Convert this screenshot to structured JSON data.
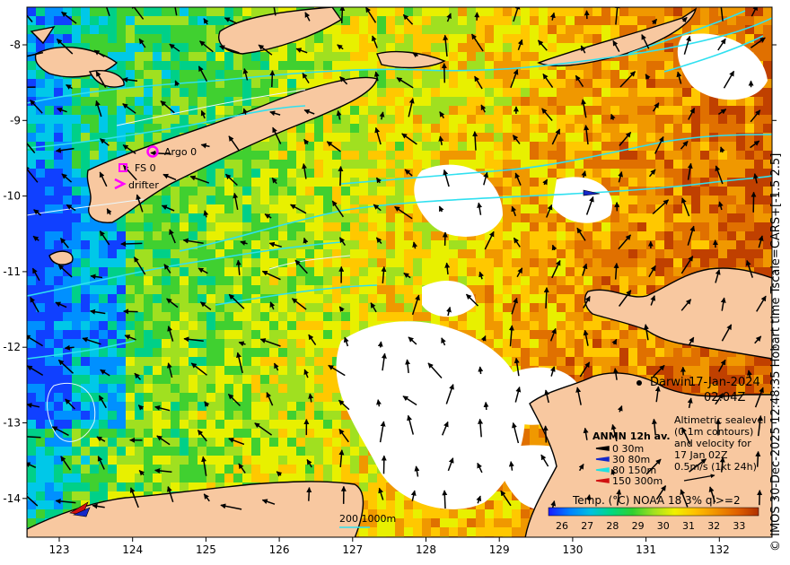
{
  "axes": {
    "x_ticks": [
      "123",
      "124",
      "125",
      "126",
      "127",
      "128",
      "129",
      "130",
      "131",
      "132"
    ],
    "y_ticks": [
      "-8",
      "-9",
      "-10",
      "-11",
      "-12",
      "-13",
      "-14"
    ]
  },
  "place_label": "Darwin",
  "date_line": "17-Jan-2024",
  "time_line": "02:04Z",
  "markers": {
    "argo": "Argo 0",
    "fs": "FS 0",
    "drifter": "drifter"
  },
  "legend_anmn": {
    "title": "ANMN 12h av.",
    "items": [
      {
        "label": "0 30m",
        "color": "#000000"
      },
      {
        "label": "30 80m",
        "color": "#1428c8"
      },
      {
        "label": "80 150m",
        "color": "#20e0e0"
      },
      {
        "label": "150 300m",
        "color": "#d01010"
      }
    ]
  },
  "legend_altimetry": {
    "lines": [
      "Altimetric sealevel",
      "(0.1m contours)",
      "and velocity for",
      "17 Jan 02Z",
      "0.5m/s (1kt 24h)"
    ]
  },
  "bathymetry_label": "200  1000m",
  "colorbar": {
    "title": "Temp. (°C) NOAA 18 3% ql>=2",
    "ticks": [
      "26",
      "27",
      "28",
      "29",
      "30",
      "31",
      "32",
      "33"
    ],
    "colors": [
      "#1a1aff",
      "#0080ff",
      "#00c0e0",
      "#00d880",
      "#30d030",
      "#a0e020",
      "#f0f000",
      "#ffc000",
      "#f09000",
      "#e06000",
      "#b03000"
    ]
  },
  "side_text": "© IMOS 30-Dec-2025 12:48:35 Hobart time Tscale=CARS+[-1.5 2.5]",
  "colors": {
    "land": "#f8c8a0",
    "contour": "#30e0f0",
    "marker": "#ff00ff"
  }
}
